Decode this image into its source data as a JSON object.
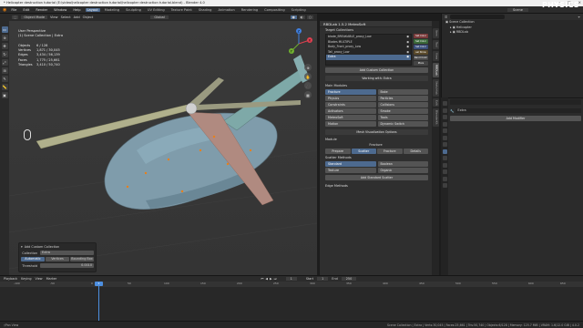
{
  "window": {
    "title": "* Helicopter destruction tutorial (E:\\video\\helicopter destruction tutorial\\helicopter destruction tutorial.blend) - Blender 4.0",
    "brand": "PHYSICS",
    "controls": [
      "–",
      "□",
      "×"
    ]
  },
  "menubar": {
    "items": [
      "File",
      "Edit",
      "Render",
      "Window",
      "Help"
    ],
    "workspaces": [
      "Layout",
      "Modeling",
      "Sculpting",
      "UV Editing",
      "Texture Paint",
      "Shading",
      "Animation",
      "Rendering",
      "Compositing",
      "Scripting"
    ],
    "active_workspace": "Layout",
    "scene_label": "Scene",
    "viewlayer_label": "ViewLayer"
  },
  "viewport": {
    "header": {
      "mode": "Object Mode",
      "menus": [
        "View",
        "Select",
        "Add",
        "Object"
      ],
      "transform": "Global"
    },
    "info_line1": "User Perspective",
    "info_line2": "(1) Scene Collection | Extra",
    "stats": [
      {
        "k": "Objects",
        "v": "6 / 128"
      },
      {
        "k": "Vertices",
        "v": "1,871 / 30,045"
      },
      {
        "k": "Edges",
        "v": "3,434 / 56,139"
      },
      {
        "k": "Faces",
        "v": "1,775 / 25,661"
      },
      {
        "k": "Triangles",
        "v": "3,410 / 50,740"
      }
    ],
    "gizmo_axes": [
      "X",
      "Y",
      "Z"
    ]
  },
  "last_operator": {
    "title": "Add Custom Collection",
    "collection_label": "Collection",
    "collection_value": "Extra",
    "options": [
      "Automatic",
      "Vertices",
      "Bounding Box"
    ],
    "selected_option": "Automatic",
    "threshold_label": "Threshold",
    "threshold_value": "0.0010"
  },
  "npanel": {
    "title": "RBDLab 1.5.2 MeteoSoft",
    "target_collections_label": "Target Collections",
    "collections": [
      {
        "name": "blade_BREAKABLE_proxy_Low",
        "selected": false
      },
      {
        "name": "Blades MULTIPLE",
        "selected": false
      },
      {
        "name": "Body_Front_proxy_Low",
        "selected": false
      },
      {
        "name": "Tail_proxy_Low",
        "selected": false
      },
      {
        "name": "Extra",
        "selected": true
      }
    ],
    "side_buttons": [
      {
        "label": "Set Color",
        "color": "#7a3b3b"
      },
      {
        "label": "Set Color",
        "color": "#3b6a3b"
      },
      {
        "label": "Set Color",
        "color": "#3b4f7a"
      },
      {
        "label": "sel Show",
        "color": "#5a4a2b"
      },
      {
        "label": "Rand Color",
        "color": "#4a4a4a"
      },
      {
        "label": "More",
        "color": "#444444"
      }
    ],
    "add_custom_collection": "Add Custom Collection",
    "working_with": "Working with: Extra",
    "main_modules_label": "Main Modules",
    "modules": [
      {
        "label": "Fracture",
        "on": true
      },
      {
        "label": "Bake",
        "on": false
      },
      {
        "label": "Physics",
        "on": false
      },
      {
        "label": "Particles",
        "on": false
      },
      {
        "label": "Constraints",
        "on": false
      },
      {
        "label": "Collisions",
        "on": false
      },
      {
        "label": "Activators",
        "on": false
      },
      {
        "label": "Smoke",
        "on": false
      },
      {
        "label": "MeteoSoft",
        "on": false
      },
      {
        "label": "Tools",
        "on": false
      },
      {
        "label": "Motion",
        "on": false
      },
      {
        "label": "Dynamic Switch",
        "on": false
      }
    ],
    "mesh_vis_options": "Mesh Visualization Options",
    "module_label": "Module",
    "fracture_label": "Fracture",
    "fracture_tabs": [
      "Prepare",
      "Scatter",
      "Fracture",
      "Details"
    ],
    "active_fracture_tab": "Scatter",
    "scatter_method_label": "Scatter Methods",
    "scatter_methods": [
      {
        "label": "Standard",
        "on": true
      },
      {
        "label": "Boolean",
        "on": false
      },
      {
        "label": "Texture",
        "on": false
      },
      {
        "label": "Organic",
        "on": false
      }
    ],
    "add_standard_scatter": "Add Standard Scatter",
    "edge_methods": "Edge Methods",
    "vertical_tabs": [
      "Item",
      "Tool",
      "View",
      "RBDLab",
      "Sketchfab",
      "Edit",
      "BlenderKit"
    ]
  },
  "outliner": {
    "header_search": "",
    "items": [
      {
        "label": "Scene Collection",
        "indent": 0
      },
      {
        "label": "Helicopter",
        "indent": 1
      },
      {
        "label": "RBDLab",
        "indent": 1
      }
    ]
  },
  "properties": {
    "object_name": "Extra",
    "add_modifier": "Add Modifier"
  },
  "timeline": {
    "menus": [
      "Playback",
      "Keying",
      "View",
      "Marker"
    ],
    "start_label": "Start",
    "start_value": "1",
    "end_label": "End",
    "end_value": "250",
    "current_frame": "1",
    "ticks": [
      "-100",
      "-50",
      "0",
      "50",
      "100",
      "150",
      "200",
      "250",
      "300",
      "350",
      "400",
      "450",
      "500",
      "550",
      "600",
      "650"
    ]
  },
  "statusbar": {
    "left": "Pan View",
    "right": "Scene Collection | Extra | Verts:30,045 | Faces:25,661 | Tris:50,740 | Objects:6/128 | Memory: 125.7 MiB | VRAM: 1.6/12.0 GiB | 4.0.2"
  }
}
